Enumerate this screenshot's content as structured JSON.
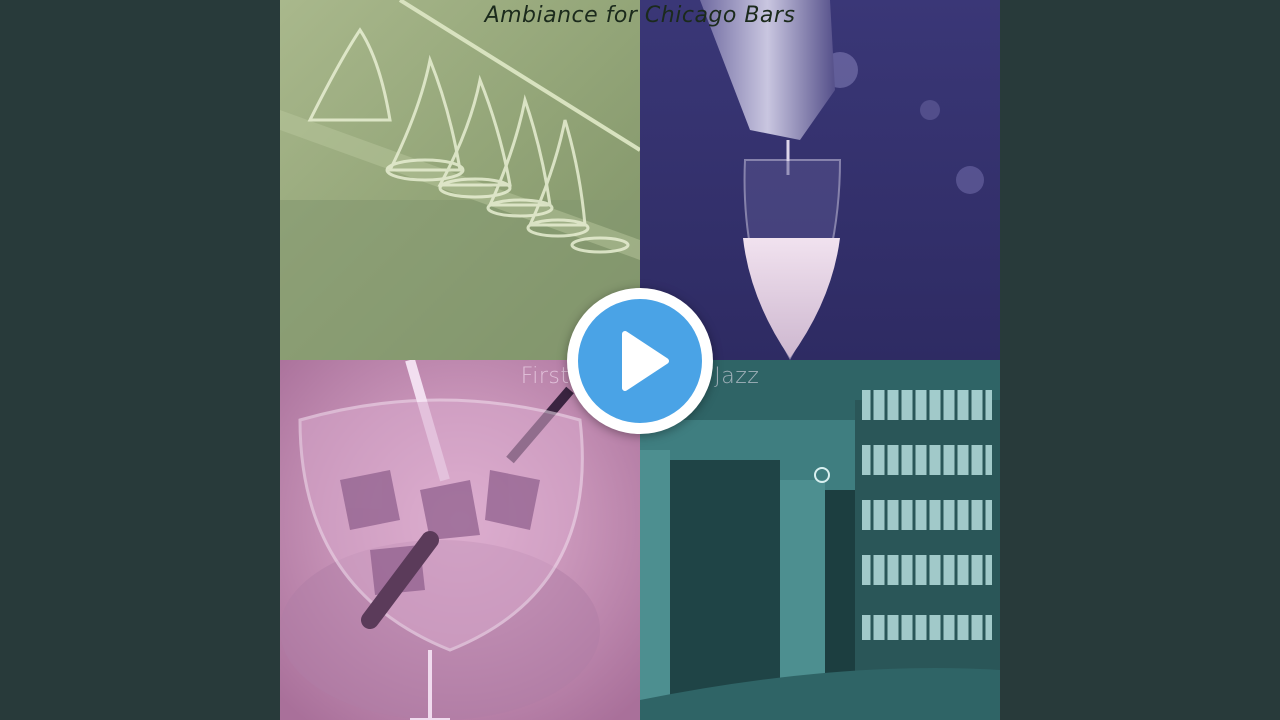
{
  "artwork": {
    "title_top": "Ambiance for Chicago Bars",
    "title_mid": "First Class Mood Jazz"
  },
  "player": {
    "play_icon": "play-icon",
    "play_color": "#4aa3e6"
  },
  "colors": {
    "page_background": "#283a3a",
    "tile_green": "#8fa27a",
    "tile_purple": "#3d3a78",
    "tile_pink": "#c58bb2",
    "tile_teal": "#3f7e80"
  }
}
